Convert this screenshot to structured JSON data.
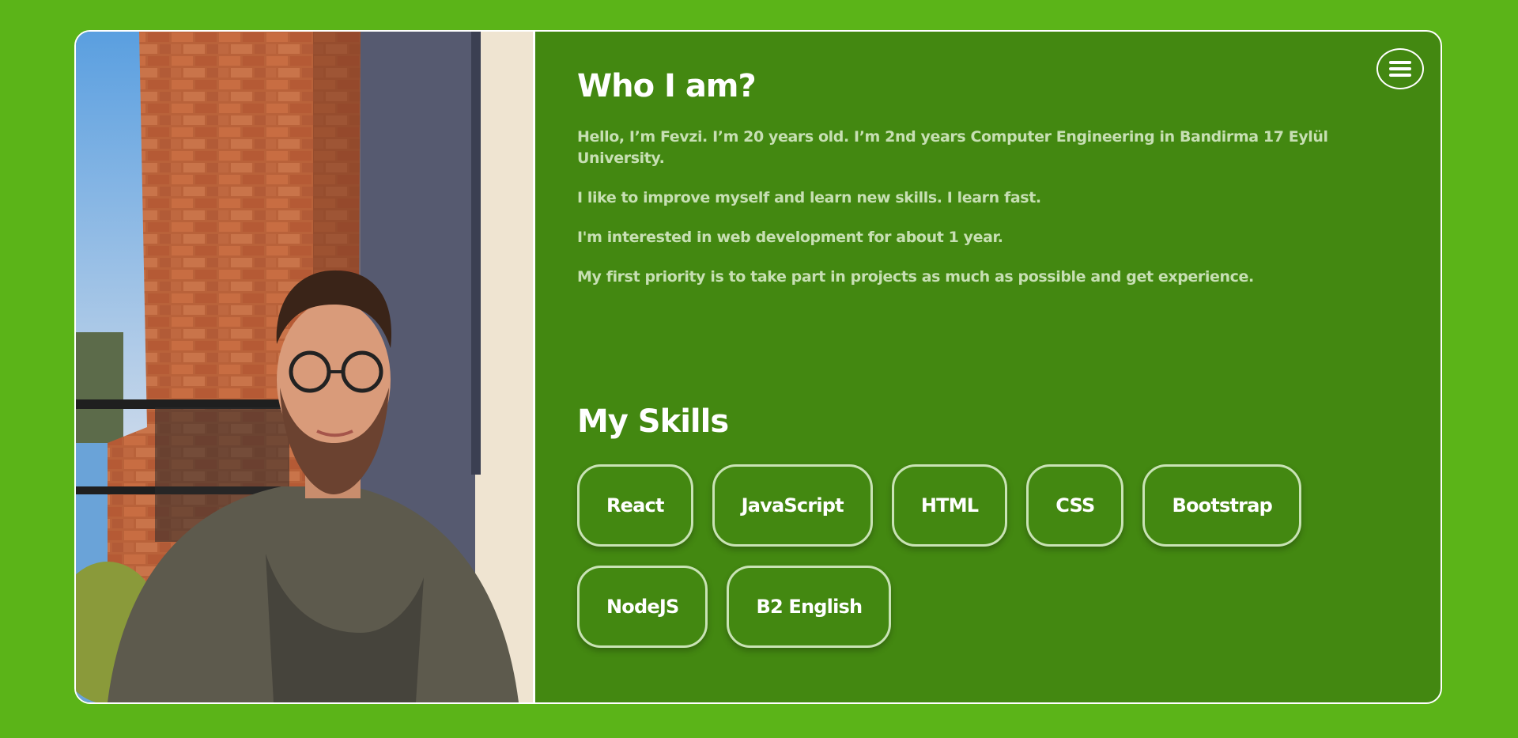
{
  "about": {
    "title": "Who I am?",
    "paragraphs": [
      "Hello, I’m Fevzi. I’m 20 years old. I’m 2nd years Computer Engineering in Bandirma 17 Eylül University.",
      "I like to improve myself and learn new skills. I learn fast.",
      "I'm interested in web development for about 1 year.",
      "My first priority is to take part in projects as much as possible and get experience."
    ]
  },
  "skills": {
    "title": "My Skills",
    "items": [
      "React",
      "JavaScript",
      "HTML",
      "CSS",
      "Bootstrap",
      "NodeJS",
      "B2 English"
    ]
  },
  "menu": {
    "icon": "hamburger-menu-icon"
  },
  "photo": {
    "subject": "portrait-photo"
  },
  "colors": {
    "background": "#5bb418",
    "card": "#438811",
    "text_muted": "#c7dfb3",
    "border": "#ffffff"
  }
}
